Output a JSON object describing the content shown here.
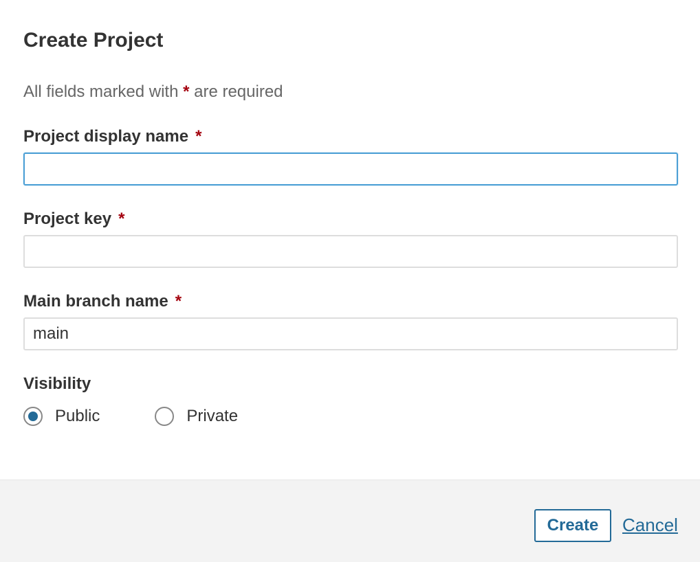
{
  "dialog": {
    "title": "Create Project",
    "required_note_prefix": "All fields marked with",
    "required_marker": "*",
    "required_note_suffix": "are required"
  },
  "fields": {
    "display_name": {
      "label": "Project display name",
      "value": "",
      "placeholder": ""
    },
    "project_key": {
      "label": "Project key",
      "value": "",
      "placeholder": ""
    },
    "main_branch": {
      "label": "Main branch name",
      "value": "main",
      "placeholder": ""
    }
  },
  "visibility": {
    "label": "Visibility",
    "options": [
      {
        "label": "Public",
        "selected": true
      },
      {
        "label": "Private",
        "selected": false
      }
    ]
  },
  "footer": {
    "create_label": "Create",
    "cancel_label": "Cancel"
  },
  "colors": {
    "accent": "#236a97",
    "required_star": "#a4030f",
    "focus_border": "#4b9fd5",
    "footer_bg": "#f3f3f3"
  }
}
